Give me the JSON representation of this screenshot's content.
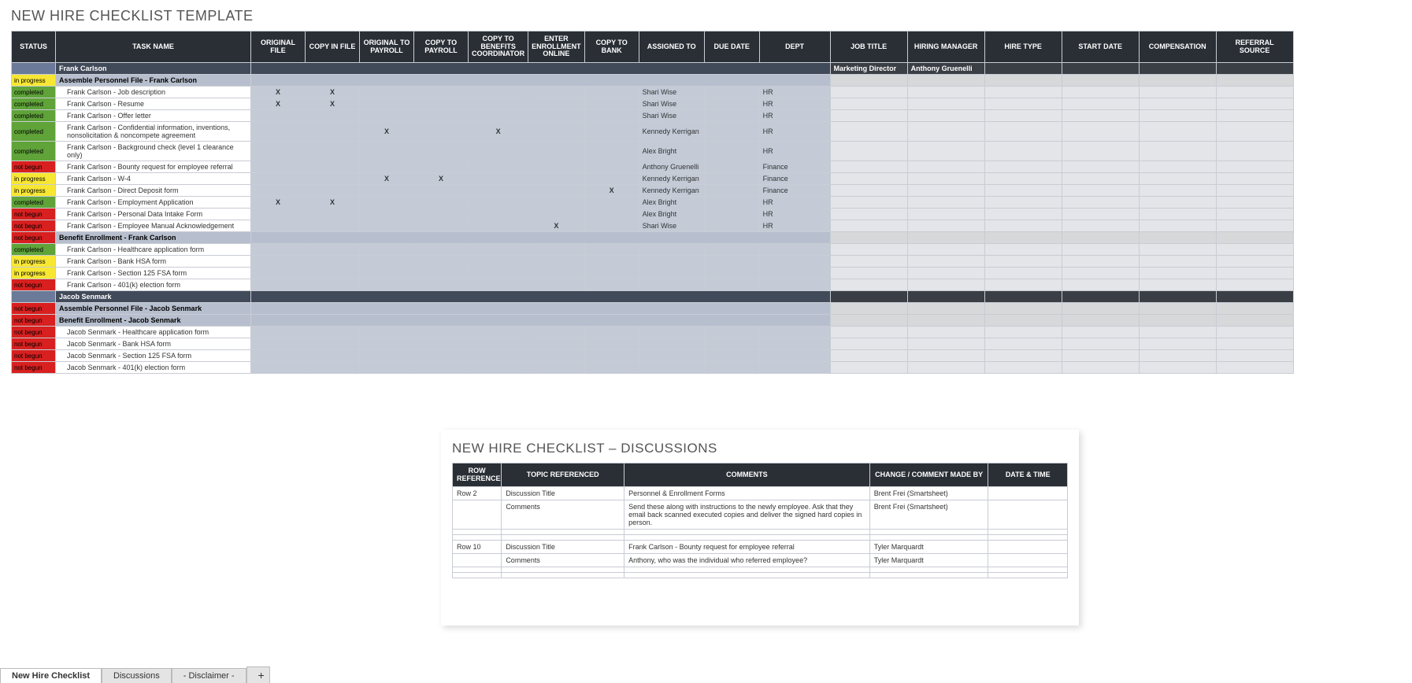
{
  "title": "NEW HIRE CHECKLIST TEMPLATE",
  "columns": [
    "STATUS",
    "TASK NAME",
    "ORIGINAL FILE",
    "COPY IN FILE",
    "ORIGINAL TO PAYROLL",
    "COPY TO PAYROLL",
    "COPY TO BENEFITS COORDINATOR",
    "ENTER ENROLLMENT ONLINE",
    "COPY TO BANK",
    "ASSIGNED TO",
    "DUE DATE",
    "DEPT",
    "JOB TITLE",
    "HIRING MANAGER",
    "HIRE TYPE",
    "START DATE",
    "COMPENSATION",
    "REFERRAL SOURCE"
  ],
  "rows": [
    {
      "type": "employee",
      "task": "Frank Carlson",
      "meta": {
        "job_title": "Marketing Director",
        "hiring_manager": "Anthony Gruenelli"
      }
    },
    {
      "type": "section",
      "status": "in progress",
      "task": "Assemble Personnel File - Frank Carlson"
    },
    {
      "type": "task",
      "status": "completed",
      "task": "Frank Carlson - Job description",
      "marks": [
        "X",
        "X",
        "",
        "",
        "",
        "",
        ""
      ],
      "assigned": "Shari Wise",
      "dept": "HR"
    },
    {
      "type": "task",
      "status": "completed",
      "task": "Frank Carlson - Resume",
      "marks": [
        "X",
        "X",
        "",
        "",
        "",
        "",
        ""
      ],
      "assigned": "Shari Wise",
      "dept": "HR"
    },
    {
      "type": "task",
      "status": "completed",
      "task": "Frank Carlson - Offer letter",
      "marks": [
        "",
        "",
        "",
        "",
        "",
        "",
        ""
      ],
      "assigned": "Shari Wise",
      "dept": "HR"
    },
    {
      "type": "task",
      "status": "completed",
      "task": "Frank Carlson - Confidential information, inventions, nonsolicitation & noncompete agreement",
      "marks": [
        "",
        "",
        "X",
        "",
        "X",
        "",
        ""
      ],
      "assigned": "Kennedy Kerrigan",
      "dept": "HR"
    },
    {
      "type": "task",
      "status": "completed",
      "task": "Frank Carlson - Background check (level 1 clearance only)",
      "marks": [
        "",
        "",
        "",
        "",
        "",
        "",
        ""
      ],
      "assigned": "Alex Bright",
      "dept": "HR"
    },
    {
      "type": "task",
      "status": "not begun",
      "task": "Frank Carlson - Bounty request for employee referral",
      "marks": [
        "",
        "",
        "",
        "",
        "",
        "",
        ""
      ],
      "assigned": "Anthony Gruenelli",
      "dept": "Finance"
    },
    {
      "type": "task",
      "status": "in progress",
      "task": "Frank Carlson - W-4",
      "marks": [
        "",
        "",
        "X",
        "X",
        "",
        "",
        ""
      ],
      "assigned": "Kennedy Kerrigan",
      "dept": "Finance"
    },
    {
      "type": "task",
      "status": "in progress",
      "task": "Frank Carlson - Direct Deposit form",
      "marks": [
        "",
        "",
        "",
        "",
        "",
        "",
        "X"
      ],
      "assigned": "Kennedy Kerrigan",
      "dept": "Finance"
    },
    {
      "type": "task",
      "status": "completed",
      "task": "Frank Carlson - Employment Application",
      "marks": [
        "X",
        "X",
        "",
        "",
        "",
        "",
        ""
      ],
      "assigned": "Alex Bright",
      "dept": "HR"
    },
    {
      "type": "task",
      "status": "not begun",
      "task": "Frank Carlson - Personal Data Intake Form",
      "marks": [
        "",
        "",
        "",
        "",
        "",
        "",
        ""
      ],
      "assigned": "Alex Bright",
      "dept": "HR"
    },
    {
      "type": "task",
      "status": "not begun",
      "task": "Frank Carlson - Employee Manual Acknowledgement",
      "marks": [
        "",
        "",
        "",
        "",
        "",
        "X",
        ""
      ],
      "assigned": "Shari Wise",
      "dept": "HR"
    },
    {
      "type": "section",
      "status": "not begun",
      "task": "Benefit Enrollment - Frank Carlson"
    },
    {
      "type": "task",
      "status": "completed",
      "task": "Frank Carlson - Healthcare application form",
      "marks": [
        "",
        "",
        "",
        "",
        "",
        "",
        ""
      ]
    },
    {
      "type": "task",
      "status": "in progress",
      "task": "Frank Carlson - Bank HSA form",
      "marks": [
        "",
        "",
        "",
        "",
        "",
        "",
        ""
      ]
    },
    {
      "type": "task",
      "status": "in progress",
      "task": "Frank Carlson - Section 125 FSA form",
      "marks": [
        "",
        "",
        "",
        "",
        "",
        "",
        ""
      ]
    },
    {
      "type": "task",
      "status": "not begun",
      "task": "Frank Carlson - 401(k) election form",
      "marks": [
        "",
        "",
        "",
        "",
        "",
        "",
        ""
      ]
    },
    {
      "type": "employee",
      "task": "Jacob Senmark"
    },
    {
      "type": "section",
      "status": "not begun",
      "task": "Assemble Personnel File - Jacob Senmark"
    },
    {
      "type": "section",
      "status": "not begun",
      "task": "Benefit Enrollment - Jacob Senmark"
    },
    {
      "type": "task",
      "status": "not begun",
      "task": "Jacob Senmark - Healthcare application form",
      "marks": [
        "",
        "",
        "",
        "",
        "",
        "",
        ""
      ]
    },
    {
      "type": "task",
      "status": "not begun",
      "task": "Jacob Senmark - Bank HSA form",
      "marks": [
        "",
        "",
        "",
        "",
        "",
        "",
        ""
      ]
    },
    {
      "type": "task",
      "status": "not begun",
      "task": "Jacob Senmark - Section 125 FSA form",
      "marks": [
        "",
        "",
        "",
        "",
        "",
        "",
        ""
      ]
    },
    {
      "type": "task",
      "status": "not begun",
      "task": "Jacob Senmark - 401(k) election form",
      "marks": [
        "",
        "",
        "",
        "",
        "",
        "",
        ""
      ]
    }
  ],
  "discussions": {
    "title": "NEW HIRE CHECKLIST  –  DISCUSSIONS",
    "columns": [
      "ROW REFERENCED",
      "TOPIC REFERENCED",
      "COMMENTS",
      "CHANGE / COMMENT MADE BY",
      "DATE & TIME"
    ],
    "rows": [
      {
        "row": "Row 2",
        "topic": "Discussion Title",
        "comments": "Personnel & Enrollment Forms",
        "made": "Brent Frei (Smartsheet)",
        "dt": ""
      },
      {
        "row": "",
        "topic": "Comments",
        "comments": "Send these along with instructions to the newly employee.  Ask that they email back scanned executed copies and deliver the signed hard copies in person.",
        "made": "Brent Frei (Smartsheet)",
        "dt": ""
      },
      {
        "row": "",
        "topic": "",
        "comments": "",
        "made": "",
        "dt": ""
      },
      {
        "row": "",
        "topic": "",
        "comments": "",
        "made": "",
        "dt": ""
      },
      {
        "row": "Row 10",
        "topic": "Discussion Title",
        "comments": "Frank Carlson - Bounty request for employee referral",
        "made": "Tyler Marquardt",
        "dt": ""
      },
      {
        "row": "",
        "topic": "Comments",
        "comments": "Anthony, who was the individual who referred employee?",
        "made": "Tyler Marquardt",
        "dt": ""
      },
      {
        "row": "",
        "topic": "",
        "comments": "",
        "made": "",
        "dt": ""
      },
      {
        "row": "",
        "topic": "",
        "comments": "",
        "made": "",
        "dt": ""
      }
    ]
  },
  "tabs": [
    "New Hire Checklist",
    "Discussions",
    "- Disclaimer -"
  ],
  "tab_add": "+"
}
